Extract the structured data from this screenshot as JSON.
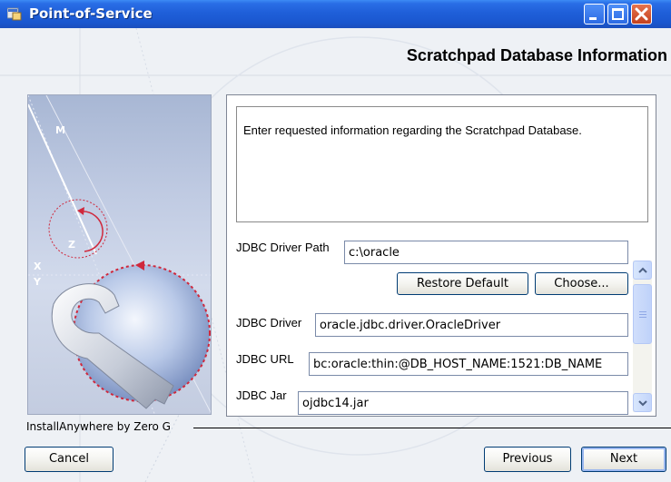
{
  "window": {
    "title": "Point-of-Service",
    "controls": [
      "minimize",
      "maximize",
      "close"
    ],
    "icon": "app-window-icon"
  },
  "header": {
    "title": "Scratchpad Database Information"
  },
  "illustration": {
    "axis_labels": [
      "M",
      "Z",
      "X",
      "Y"
    ],
    "icon": "wrench-gear-illustration"
  },
  "content": {
    "description": "Enter requested information regarding the Scratchpad Database.",
    "fields": [
      {
        "label": "JDBC Driver Path",
        "value": "c:\\oracle"
      },
      {
        "label": "JDBC Driver",
        "value": "oracle.jdbc.driver.OracleDriver"
      },
      {
        "label": "JDBC URL",
        "value": "bc:oracle:thin:@DB_HOST_NAME:1521:DB_NAME"
      },
      {
        "label": "JDBC Jar",
        "value": "ojdbc14.jar"
      }
    ],
    "restore_default_label": "Restore Default",
    "choose_label": "Choose..."
  },
  "footer": {
    "brand": "InstallAnywhere by Zero G",
    "cancel_label": "Cancel",
    "previous_label": "Previous",
    "next_label": "Next"
  },
  "colors": {
    "titlebar": "#1f5fd9",
    "close_button": "#c4411e",
    "accent_red": "#d0283c"
  }
}
